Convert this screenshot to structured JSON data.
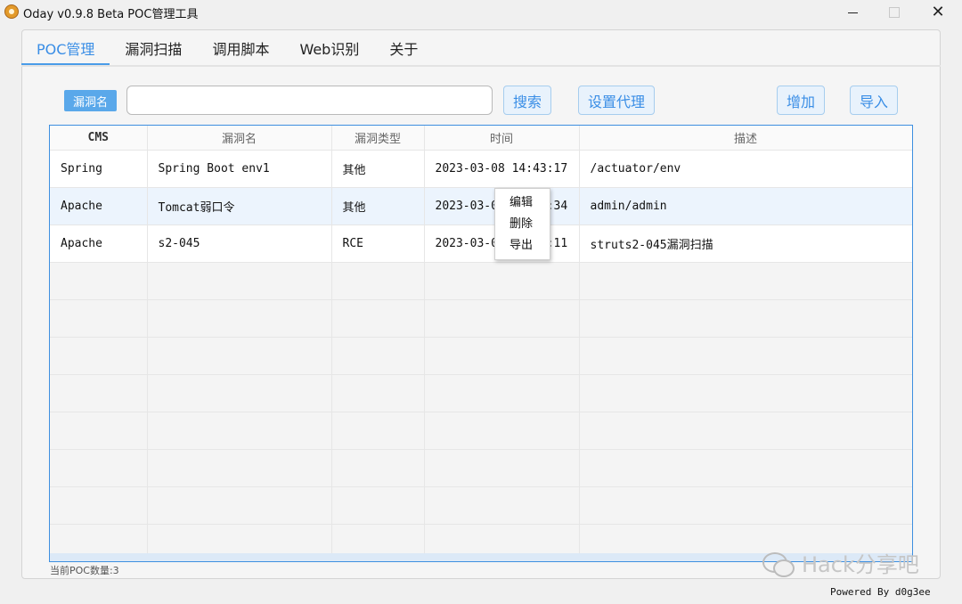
{
  "window": {
    "title": "Oday v0.9.8 Beta POC管理工具"
  },
  "tabs": [
    {
      "label": "POC管理",
      "active": true
    },
    {
      "label": "漏洞扫描"
    },
    {
      "label": "调用脚本"
    },
    {
      "label": "Web识别"
    },
    {
      "label": "关于"
    }
  ],
  "toolbar": {
    "field_label": "漏洞名",
    "search_value": "",
    "search_button": "搜索",
    "proxy_button": "设置代理",
    "add_button": "增加",
    "import_button": "导入"
  },
  "table": {
    "columns": [
      "CMS",
      "漏洞名",
      "漏洞类型",
      "时间",
      "描述"
    ],
    "rows": [
      [
        "Spring",
        "Spring Boot env1",
        "其他",
        "2023-03-08 14:43:17",
        "/actuator/env"
      ],
      [
        "Apache",
        "Tomcat弱口令",
        "其他",
        "2023-03-08 14:43:34",
        "admin/admin"
      ],
      [
        "Apache",
        "s2-045",
        "RCE",
        "2023-03-08 14:43:11",
        "struts2-045漏洞扫描"
      ]
    ],
    "selected_row": 1
  },
  "context_menu": {
    "items": [
      "编辑",
      "删除",
      "导出"
    ]
  },
  "status": {
    "count_text": "当前POC数量:3"
  },
  "footer": {
    "powered_by": "Powered By d0g3ee"
  },
  "watermark": {
    "text": "Hack分享吧"
  },
  "colors": {
    "accent": "#3a8ee6",
    "selected_row": "#ecf4fd",
    "table_border": "#3d8fe0"
  }
}
